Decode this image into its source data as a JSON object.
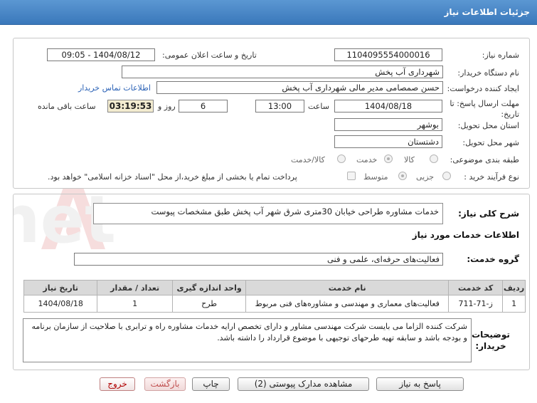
{
  "header": {
    "title": "جزئیات اطلاعات نیاز"
  },
  "form": {
    "need_number_label": "شماره نیاز:",
    "need_number": "1104095554000016",
    "announce_label": "تاریخ و ساعت اعلان عمومی:",
    "announce_value": "1404/08/12 - 09:05",
    "buyer_org_label": "نام دستگاه خریدار:",
    "buyer_org": "شهرداری آب پخش",
    "creator_label": "ایجاد کننده درخواست:",
    "creator": "حسن صمصامی مدیر مالی شهرداری آب پخش",
    "contact_link": "اطلاعات تماس خریدار",
    "deadline_label": "مهلت ارسال پاسخ: تا تاریخ:",
    "deadline_date": "1404/08/18",
    "time_label": "ساعت",
    "deadline_time": "13:00",
    "days_value": "6",
    "days_label": "روز و",
    "countdown": "03:19:53",
    "remaining_label": "ساعت باقی مانده",
    "province_label": "استان محل تحویل:",
    "province": "بوشهر",
    "city_label": "شهر محل تحویل:",
    "city": "دشتستان",
    "category_label": "طبقه بندی موضوعی:",
    "category_options": [
      "کالا",
      "خدمت",
      "کالا/خدمت"
    ],
    "category_selected": "خدمت",
    "process_label": "نوع فرآیند خرید :",
    "process_options": [
      "جزیی",
      "متوسط"
    ],
    "process_selected": "متوسط",
    "payment_note": "پرداخت تمام یا بخشی از مبلغ خرید،از محل \"اسناد خزانه اسلامی\" خواهد بود."
  },
  "details": {
    "general_desc_label": "شرح کلی نیاز:",
    "general_desc": "خدمات مشاوره طراحی خیابان 30متری شرق شهر آب پخش طبق مشخصات پیوست",
    "services_title": "اطلاعات خدمات مورد نیاز",
    "service_group_label": "گروه خدمت:",
    "service_group": "فعالیت‌های حرفه‌ای، علمی و فنی",
    "table": {
      "headers": [
        "ردیف",
        "کد خدمت",
        "نام خدمت",
        "واحد اندازه گیری",
        "تعداد / مقدار",
        "تاریخ نیاز"
      ],
      "rows": [
        [
          "1",
          "ز-71-711",
          "فعالیت‌های معماری و مهندسی و مشاوره‌های فنی مربوط",
          "طرح",
          "1",
          "1404/08/18"
        ]
      ]
    },
    "buyer_notes_label": "توضیحات خریدار:",
    "buyer_notes": "شرکت کننده الزاما می بایست شرکت مهندسی مشاور و دارای تخصص ارایه خدمات مشاوره راه و ترابری با صلاحیت از سازمان برنامه و بودجه باشد و سابقه تهیه طرحهای توجیهی با موضوع قرارداد را داشته باشد."
  },
  "buttons": {
    "reply": "پاسخ به نیاز",
    "attachments": "مشاهده مدارک پیوستی (2)",
    "print": "چاپ",
    "back": "بازگشت",
    "exit": "خروج"
  },
  "watermark": {
    "text": "AriaTender.net"
  },
  "colors": {
    "header": "#3a78bb",
    "link": "#2b62b6",
    "timer_bg": "#f3ecd0",
    "exit": "#b00000"
  }
}
